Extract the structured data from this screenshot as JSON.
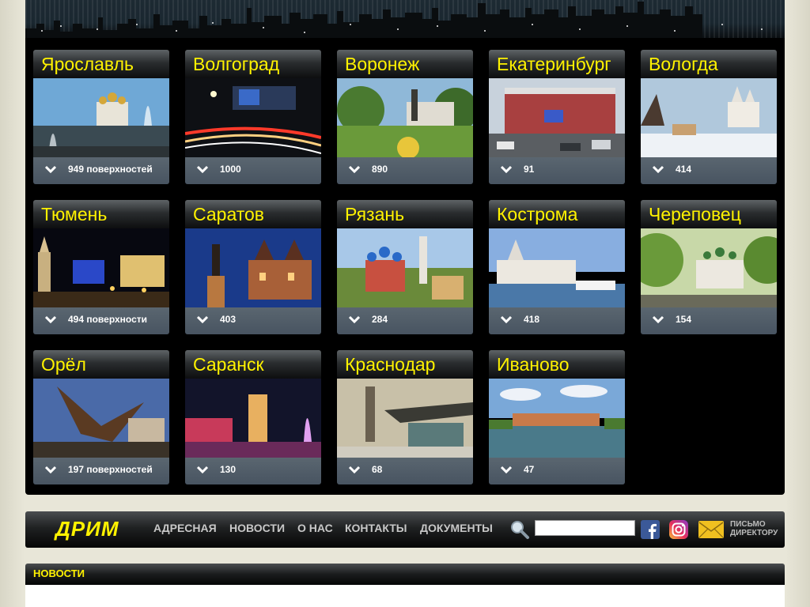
{
  "cities": [
    {
      "name": "Ярославль",
      "count": "949 поверхностей"
    },
    {
      "name": "Волгоград",
      "count": "1000"
    },
    {
      "name": "Воронеж",
      "count": "890"
    },
    {
      "name": "Екатеринбург",
      "count": "91"
    },
    {
      "name": "Вологда",
      "count": "414"
    },
    {
      "name": "Тюмень",
      "count": "494 поверхности"
    },
    {
      "name": "Саратов",
      "count": "403"
    },
    {
      "name": "Рязань",
      "count": "284"
    },
    {
      "name": "Кострома",
      "count": "418"
    },
    {
      "name": "Череповец",
      "count": "154"
    },
    {
      "name": "Орёл",
      "count": "197 поверхностей"
    },
    {
      "name": "Саранск",
      "count": "130"
    },
    {
      "name": "Краснодар",
      "count": "68"
    },
    {
      "name": "Иваново",
      "count": "47"
    }
  ],
  "nav": {
    "logo": "ДРИМ",
    "items": [
      "АДРЕСНАЯ",
      "НОВОСТИ",
      "О НАС",
      "КОНТАКТЫ",
      "ДОКУМЕНТЫ"
    ],
    "search_value": "",
    "letter_line1": "ПИСЬМО",
    "letter_line2": "ДИРЕКТОРУ"
  },
  "news": {
    "title": "НОВОСТИ"
  },
  "colors": {
    "accent_yellow": "#fff200",
    "panel_black": "#000000",
    "footer_slate": "#505c68"
  }
}
